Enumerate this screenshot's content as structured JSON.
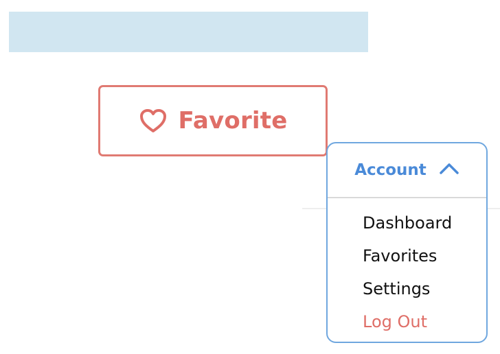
{
  "favorite_button": {
    "label": "Favorite",
    "icon": "heart-icon"
  },
  "account_menu": {
    "label": "Account",
    "icon": "chevron-up-icon",
    "expanded": true,
    "items": [
      {
        "label": "Dashboard"
      },
      {
        "label": "Favorites"
      },
      {
        "label": "Settings"
      },
      {
        "label": "Log Out"
      }
    ]
  },
  "colors": {
    "banner": "#d1e6f1",
    "favorite_accent": "#df6e67",
    "account_accent": "#4a8ad8",
    "logout_text": "#df6e67"
  }
}
